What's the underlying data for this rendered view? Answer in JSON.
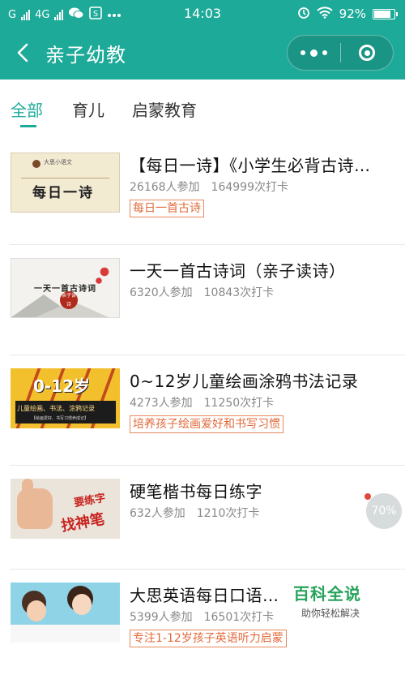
{
  "status_bar": {
    "carrier1": "G",
    "carrier2": "4G",
    "time": "14:03",
    "battery": "92%",
    "battery_level": 0.92
  },
  "nav": {
    "title": "亲子幼教"
  },
  "tabs": [
    {
      "label": "全部",
      "active": true
    },
    {
      "label": "育儿",
      "active": false
    },
    {
      "label": "启蒙教育",
      "active": false
    }
  ],
  "items": [
    {
      "title": "【每日一诗】《小学生必背古诗…",
      "participants": "26168人参加",
      "checkins": "164999次打卡",
      "tag": "每日一首古诗",
      "thumb_text": "每日一诗",
      "thumb_small": "大思小语文"
    },
    {
      "title": "一天一首古诗词（亲子读诗）",
      "participants": "6320人参加",
      "checkins": "10843次打卡",
      "tag": "",
      "thumb_text": "一天一首古诗词",
      "thumb_stamp": "亲子读诗"
    },
    {
      "title": "0~12岁儿童绘画涂鸦书法记录",
      "participants": "4273人参加",
      "checkins": "11250次打卡",
      "tag": "培养孩子绘画爱好和书写习惯",
      "thumb_text": "0-12岁",
      "thumb_sub": "儿童绘画、书法、涂鸦记录",
      "thumb_sub2": "【绘画爱好、书写习惯养成记】"
    },
    {
      "title": "硬笔楷书每日练字",
      "participants": "632人参加",
      "checkins": "1210次打卡",
      "tag": "",
      "thumb_text1": "要练字",
      "thumb_text2": "找神笔"
    },
    {
      "title": "大思英语每日口语练习",
      "participants": "5399人参加",
      "checkins": "16501次打卡",
      "tag": "专注1-12岁孩子英语听力启蒙"
    }
  ],
  "floating": {
    "progress": "70%"
  },
  "watermark": {
    "title": "百科全说",
    "subtitle": "助你轻松解决"
  },
  "colors": {
    "brand": "#1eaa98",
    "tag": "#e06a3a"
  }
}
